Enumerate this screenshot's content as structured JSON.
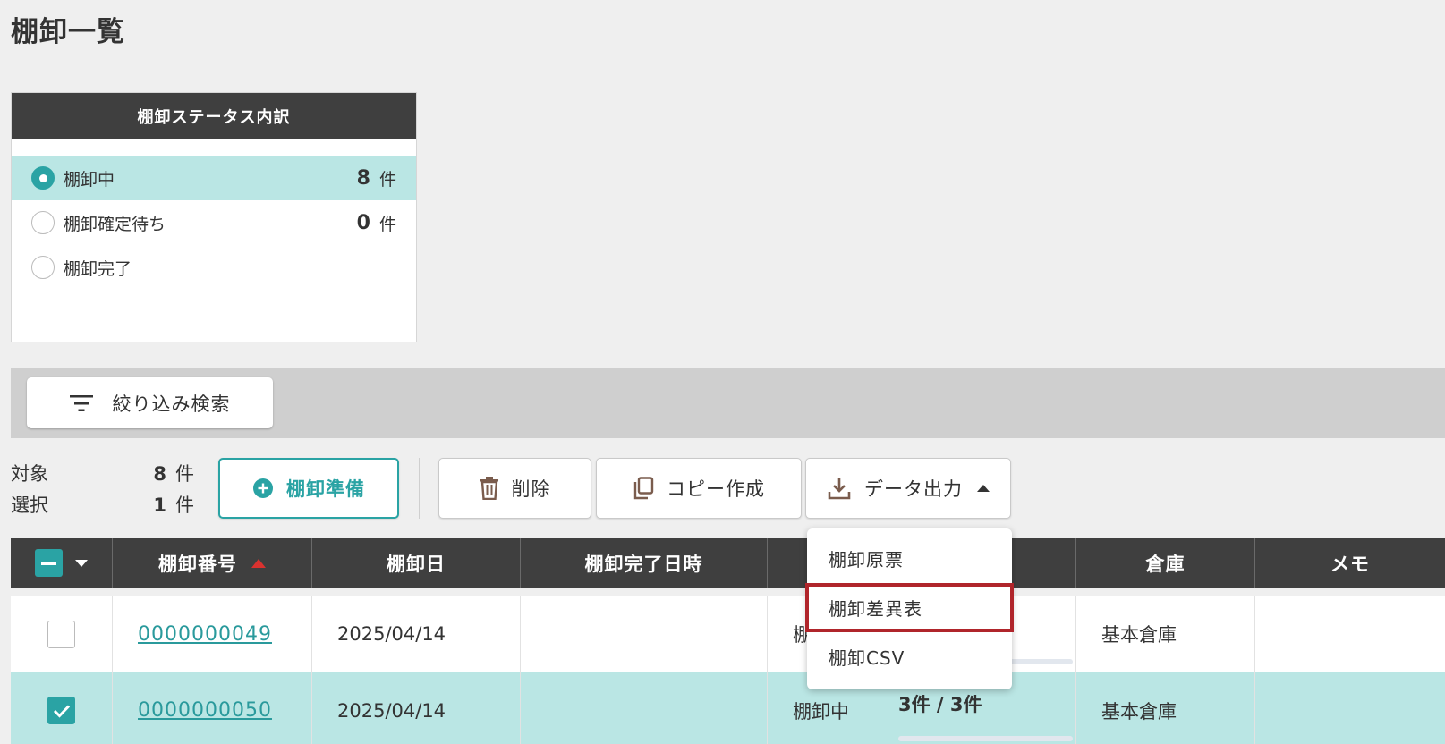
{
  "page": {
    "title": "棚卸一覧"
  },
  "status_panel": {
    "title": "棚卸ステータス内訳",
    "items": [
      {
        "label": "棚卸中",
        "count": "8",
        "unit": "件",
        "selected": true
      },
      {
        "label": "棚卸確定待ち",
        "count": "0",
        "unit": "件",
        "selected": false
      },
      {
        "label": "棚卸完了",
        "count": "",
        "unit": "",
        "selected": false
      }
    ]
  },
  "filter": {
    "button_label": "絞り込み検索"
  },
  "counts": {
    "target_label": "対象",
    "target_value": "8",
    "target_unit": "件",
    "selected_label": "選択",
    "selected_value": "1",
    "selected_unit": "件"
  },
  "toolbar": {
    "prepare_label": "棚卸準備",
    "delete_label": "削除",
    "copy_label": "コピー作成",
    "export_label": "データ出力"
  },
  "export_menu": {
    "items": [
      "棚卸原票",
      "棚卸差異表",
      "棚卸CSV"
    ],
    "highlighted_index": 1
  },
  "table": {
    "columns": [
      "棚卸番号",
      "棚卸日",
      "棚卸完了日時",
      "",
      "倉庫",
      "メモ"
    ],
    "rows": [
      {
        "checked": false,
        "number": "0000000049",
        "date": "2025/04/14",
        "completed": "",
        "status": "棚",
        "progress_text": "",
        "progress": 0.0,
        "warehouse": "基本倉庫",
        "memo": ""
      },
      {
        "checked": true,
        "number": "0000000050",
        "date": "2025/04/14",
        "completed": "",
        "status": "棚卸中",
        "progress_text": "3件 / 3件",
        "progress": 1.0,
        "warehouse": "基本倉庫",
        "memo": ""
      }
    ]
  },
  "colors": {
    "accent": "#2aa3a4",
    "header_bg": "#3f3f3f",
    "selected_row": "#bae6e4",
    "highlight_border": "#b0252b",
    "progress": "#0f5b78"
  }
}
